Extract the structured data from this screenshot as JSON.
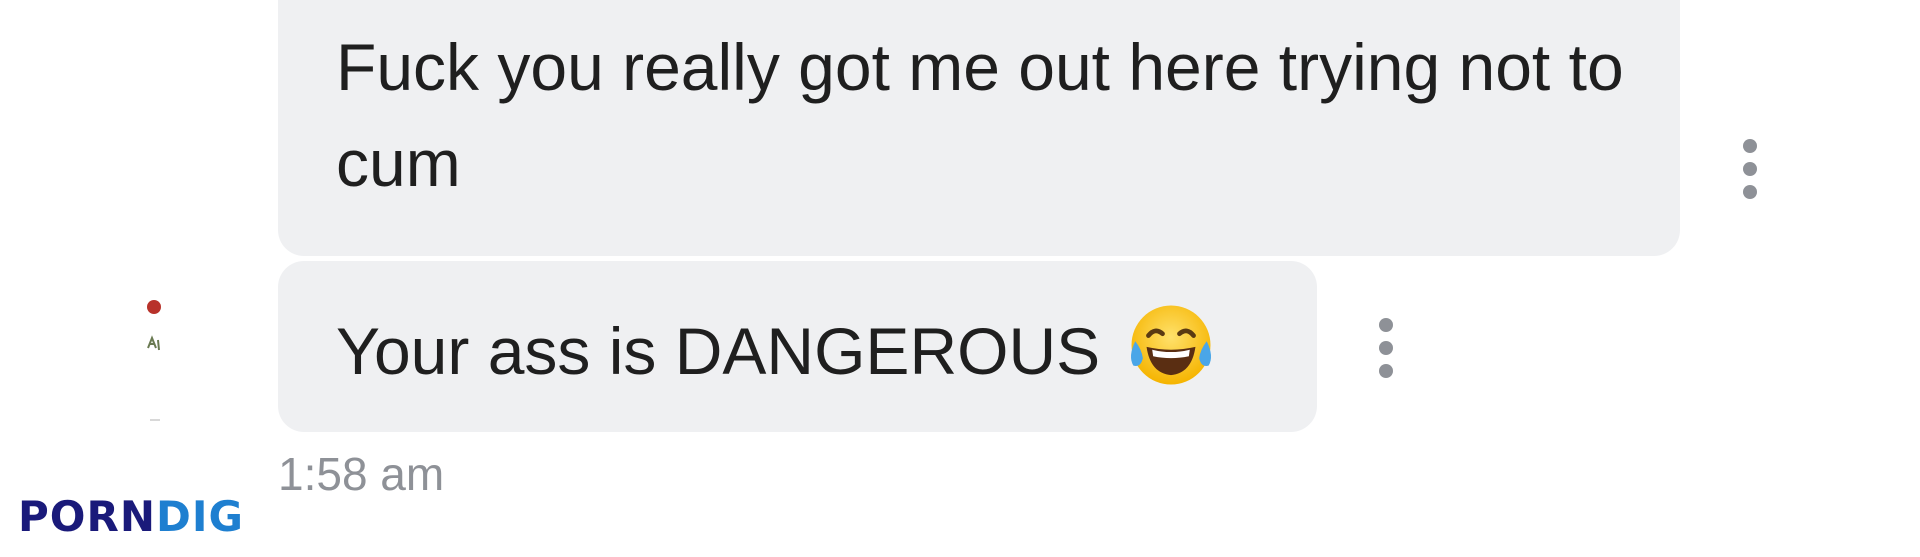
{
  "messages": [
    {
      "text": "Fuck you really got me out here trying not to cum",
      "has_emoji": false
    },
    {
      "text": "Your ass is DANGEROUS",
      "emoji": "face-with-tears-of-joy"
    }
  ],
  "timestamp": "1:58 am",
  "watermark": {
    "part1": "PORN",
    "part2": "DIG"
  },
  "colors": {
    "bubble_background": "#eff0f2",
    "text": "#1f1f1f",
    "meta_text": "#8e9197",
    "watermark_dark": "#1a1a7a",
    "watermark_light": "#1e7fd0"
  }
}
